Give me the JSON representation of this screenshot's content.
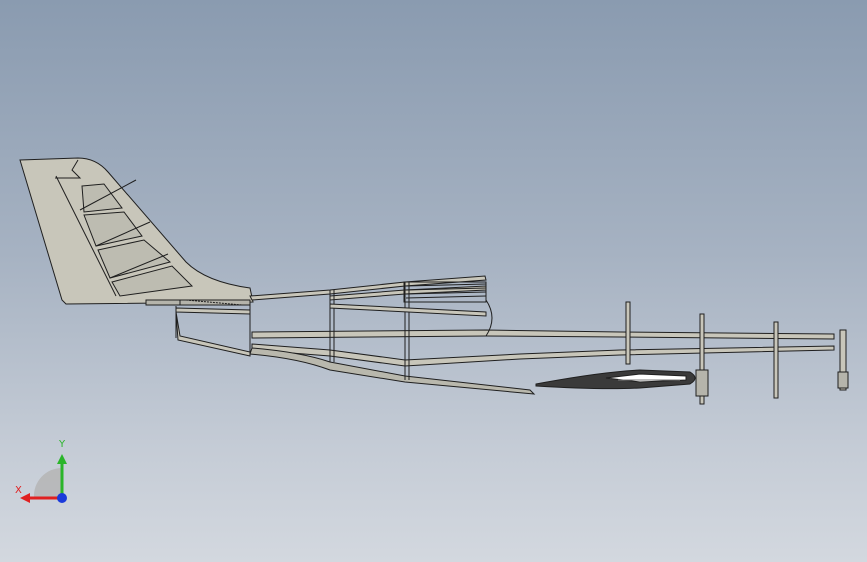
{
  "viewport": {
    "background_top": "#8a9bb0",
    "background_bottom": "#d3d8df"
  },
  "model": {
    "view": "right side view",
    "fill_color": "#c8c6ba",
    "edge_color": "#1f1f1f",
    "highlight_color": "#ffffff"
  },
  "triad": {
    "x_label": "X",
    "y_label": "Y",
    "x_color": "#e02020",
    "y_color": "#2ab52a",
    "z_color": "#1a3adb"
  }
}
